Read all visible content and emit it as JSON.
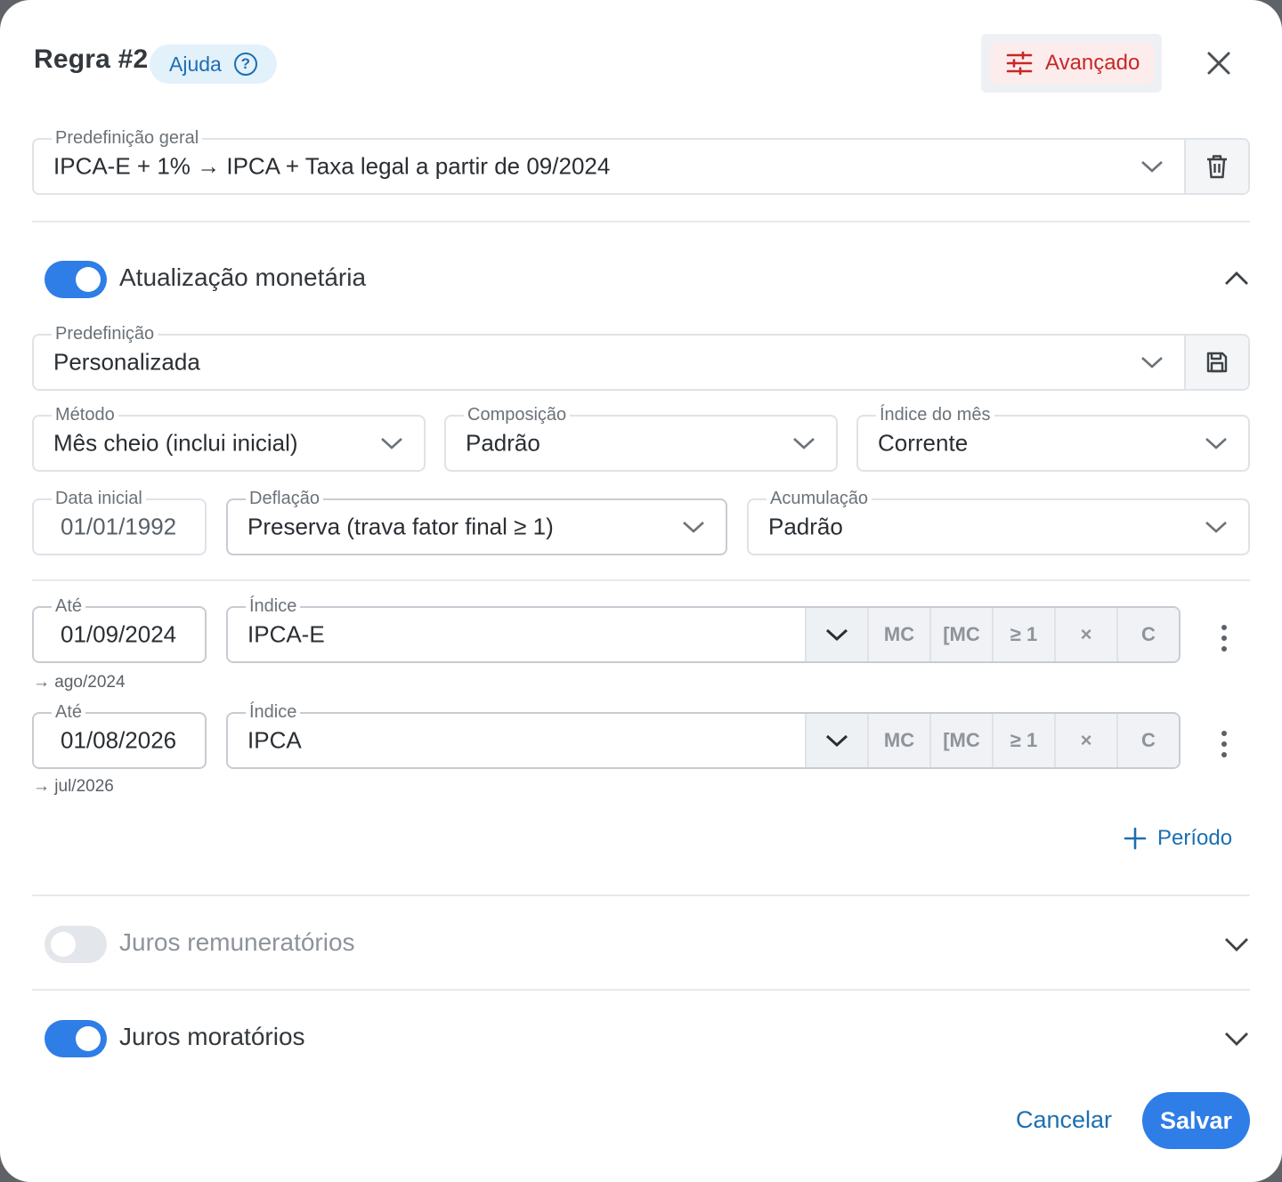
{
  "header": {
    "title": "Regra #2",
    "help_label": "Ajuda",
    "help_icon": "?",
    "advanced_label": "Avançado"
  },
  "general_preset": {
    "label": "Predefinição geral",
    "value": "IPCA-E + 1% → IPCA + Taxa legal a partir de 09/2024"
  },
  "monetary": {
    "title": "Atualização monetária",
    "enabled": true,
    "preset": {
      "label": "Predefinição",
      "value": "Personalizada"
    },
    "method": {
      "label": "Método",
      "value": "Mês cheio (inclui inicial)"
    },
    "composition": {
      "label": "Composição",
      "value": "Padrão"
    },
    "month_index": {
      "label": "Índice do mês",
      "value": "Corrente"
    },
    "start_date": {
      "label": "Data inicial",
      "value": "01/01/1992"
    },
    "deflation": {
      "label": "Deflação",
      "value": "Preserva (trava fator final ≥ 1)"
    },
    "accumulation": {
      "label": "Acumulação",
      "value": "Padrão"
    },
    "periods": [
      {
        "until_label": "Até",
        "until": "01/09/2024",
        "hint": "→ ago/2024",
        "index_label": "Índice",
        "index": "IPCA-E"
      },
      {
        "until_label": "Até",
        "until": "01/08/2026",
        "hint": "→ jul/2026",
        "index_label": "Índice",
        "index": "IPCA"
      }
    ],
    "index_buttons": [
      "MC",
      "[MC",
      "≥ 1",
      "×",
      "C"
    ],
    "add_period_label": "Período"
  },
  "remuneratory": {
    "title": "Juros remuneratórios",
    "enabled": false
  },
  "moratory": {
    "title": "Juros moratórios",
    "enabled": true
  },
  "footer": {
    "cancel_label": "Cancelar",
    "save_label": "Salvar"
  },
  "colors": {
    "primary": "#2f7de6",
    "link": "#1d6fb0",
    "danger": "#c62828"
  }
}
